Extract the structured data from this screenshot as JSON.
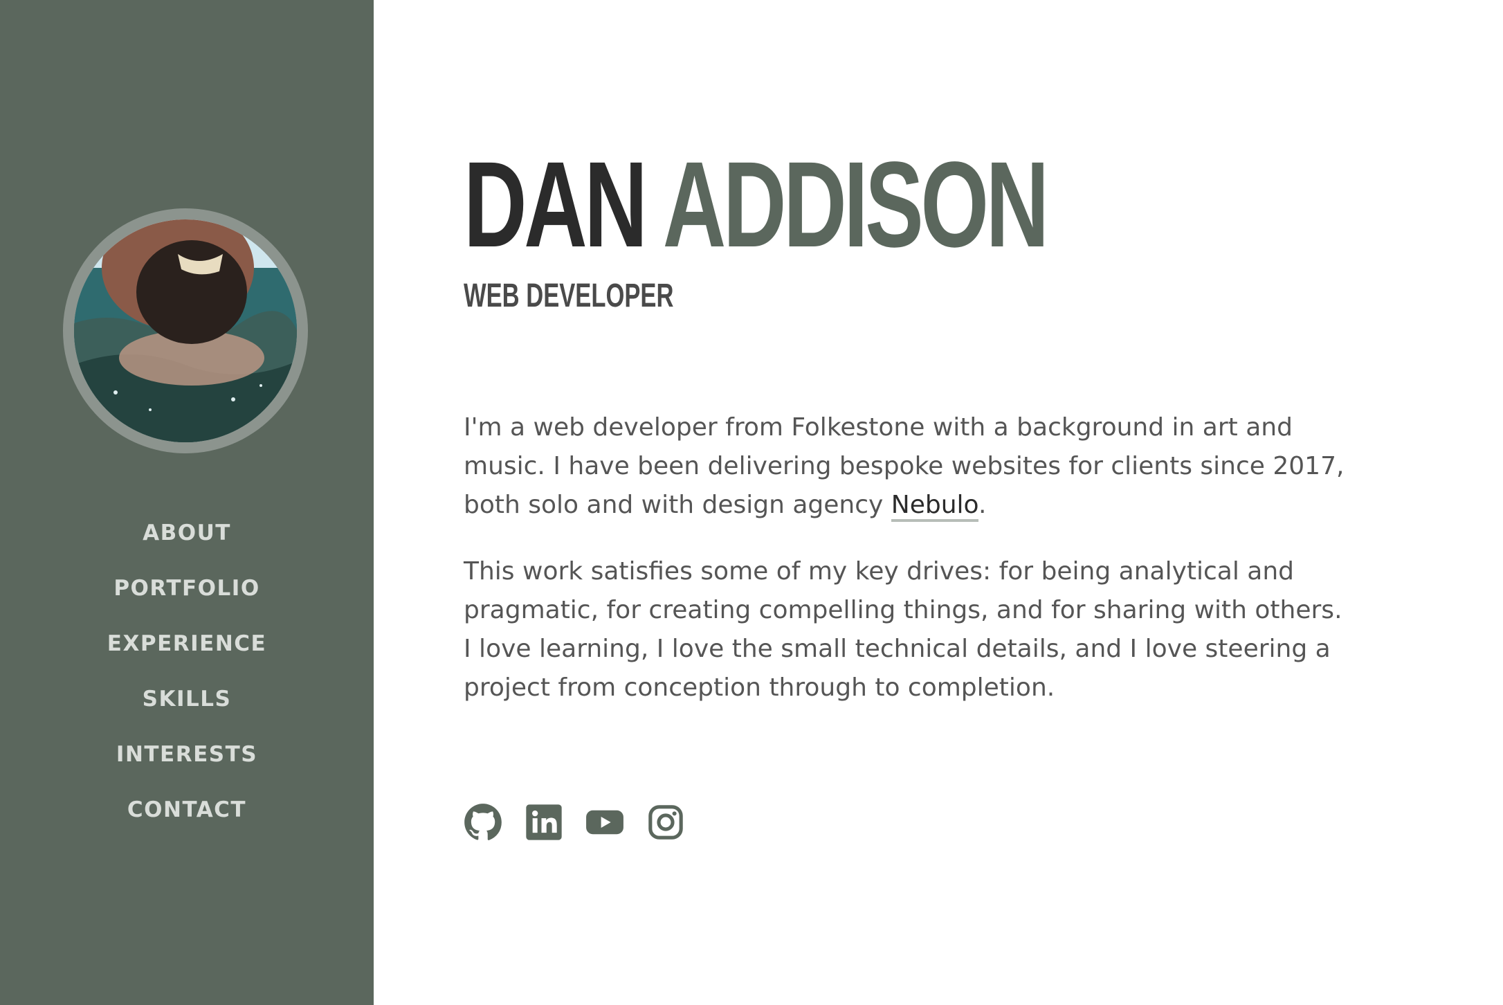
{
  "profile": {
    "first_name": "DAN",
    "last_name": "ADDISON",
    "role": "WEB DEVELOPER",
    "avatar_icon": "profile-photo"
  },
  "nav": {
    "items": [
      {
        "label": "ABOUT"
      },
      {
        "label": "PORTFOLIO"
      },
      {
        "label": "EXPERIENCE"
      },
      {
        "label": "SKILLS"
      },
      {
        "label": "INTERESTS"
      },
      {
        "label": "CONTACT"
      }
    ]
  },
  "bio": {
    "p1_text": "I'm a web developer from Folkestone with a background in art and music. I have been delivering bespoke websites for clients since 2017, both solo and with design agency ",
    "p1_link": "Nebulo",
    "p1_end": ".",
    "p2_text": "This work satisfies some of my key drives: for being analytical and pragmatic, for creating compelling things, and for sharing with others. I love learning, I love the small technical details, and I love steering a project from conception through to completion."
  },
  "social": {
    "icons": [
      "github-icon",
      "linkedin-icon",
      "youtube-icon",
      "instagram-icon"
    ]
  },
  "colors": {
    "sidebar_bg": "#5b675d",
    "accent": "#5b675d",
    "nav_text": "#d9ddd9",
    "body_text": "#555555",
    "heading_dark": "#2b2b2b"
  }
}
